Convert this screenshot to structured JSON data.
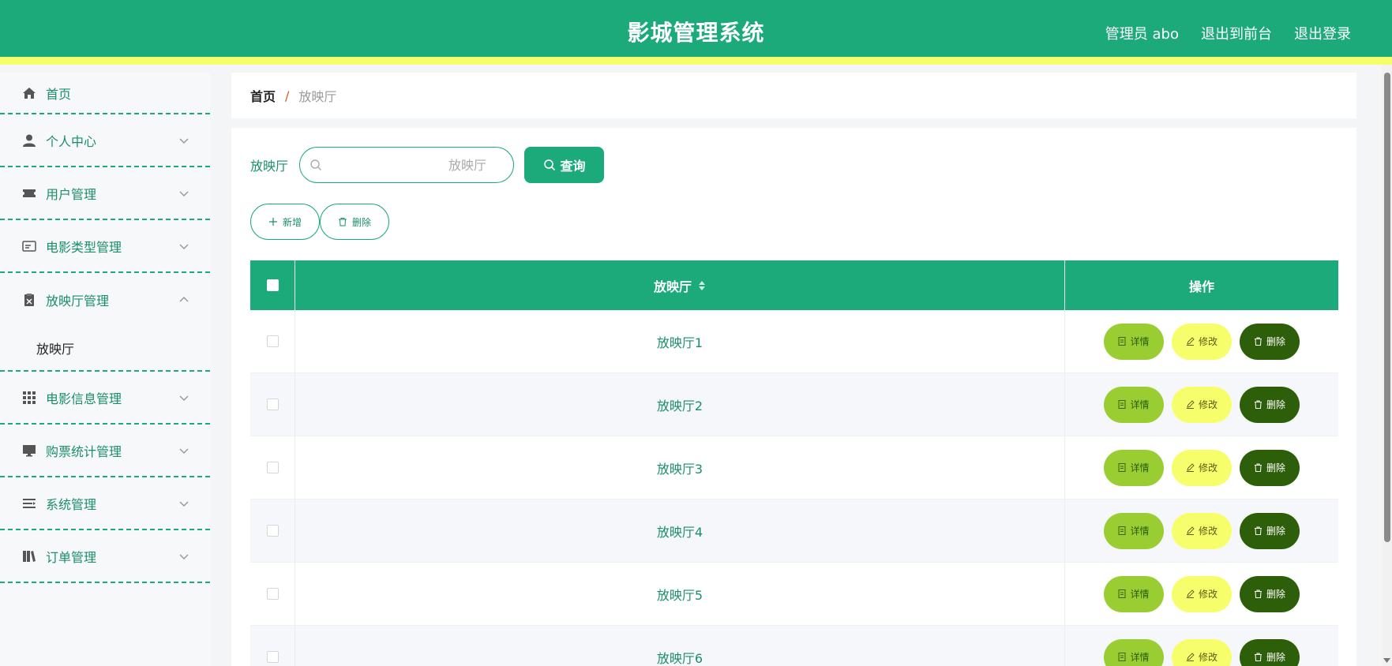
{
  "header": {
    "title": "影城管理系统",
    "user": "管理员 abo",
    "to_front": "退出到前台",
    "logout": "退出登录"
  },
  "sidebar": {
    "items": [
      {
        "label": "首页",
        "icon": "home-icon"
      },
      {
        "label": "个人中心",
        "icon": "user-icon"
      },
      {
        "label": "用户管理",
        "icon": "ticket-icon"
      },
      {
        "label": "电影类型管理",
        "icon": "id-card-icon"
      },
      {
        "label": "放映厅管理",
        "icon": "clipboard-icon",
        "open": true,
        "children": [
          "放映厅"
        ]
      },
      {
        "label": "电影信息管理",
        "icon": "grid-icon"
      },
      {
        "label": "购票统计管理",
        "icon": "monitor-icon"
      },
      {
        "label": "系统管理",
        "icon": "list-icon"
      },
      {
        "label": "订单管理",
        "icon": "book-icon"
      }
    ]
  },
  "breadcrumb": {
    "home": "首页",
    "separator": "/",
    "current": "放映厅"
  },
  "search": {
    "label": "放映厅",
    "placeholder": "放映厅",
    "value": "",
    "button": "查询"
  },
  "actions": {
    "add": "新增",
    "delete": "删除"
  },
  "table": {
    "columns": {
      "name": "放映厅",
      "ops": "操作"
    },
    "rows": [
      "放映厅1",
      "放映厅2",
      "放映厅3",
      "放映厅4",
      "放映厅5",
      "放映厅6"
    ],
    "row_actions": {
      "detail": "详情",
      "edit": "修改",
      "delete": "删除"
    }
  },
  "colors": {
    "primary": "#1daa7a",
    "accent_yellow": "#f6ff6b",
    "detail_green": "#9acd32",
    "delete_dark": "#2d5f0a"
  }
}
